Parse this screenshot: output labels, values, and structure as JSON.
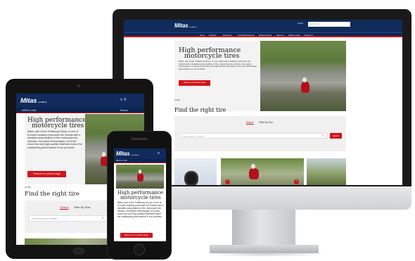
{
  "site": {
    "logo": "Mitas",
    "logo_sub": "by trelleborg",
    "colors": {
      "navy": "#102b5c",
      "red": "#d3141b"
    }
  },
  "monitor": {
    "util_label": "Search",
    "search_placeholder": "Search here",
    "nav": [
      "Home",
      "Products",
      "Motorsport",
      "Technical Resources",
      "Media & Events",
      "About Us",
      "Dealer Locator",
      "Contact Us"
    ],
    "hero_title_1": "High performance",
    "hero_title_2": "motorcycle tires",
    "hero_text": "Mitas, part of the Trelleborg Group, is one of Europe's leading motorcycle tire brands with a decades-long tradition in the motorcycle tire industry. Innovative technologies, in-house know-how and high quality materials ensure the outstanding performance of our products.",
    "hero_button": "Discover our product range",
    "breadcrumb": "HOME",
    "find_title": "Find the right tire",
    "tab_search": "Search",
    "tab_filter": "Filter By Size",
    "input_placeholder": "Product name or number",
    "search_button": "Search"
  },
  "tablet": {
    "sub_left": "MENU & NAV",
    "sub_right": "Search",
    "hero_title_1": "High performance",
    "hero_title_2": "motorcycle tires",
    "hero_text": "Mitas, part of the Trelleborg Group, is one of Europe's leading motorcycle tire brands with a decades-long tradition in the motorcycle tire industry. Innovative technologies, in-house know-how and high quality materials ensure the outstanding performance of our products.",
    "hero_button": "Discover our product range",
    "breadcrumb": "HOME",
    "find_title": "Find the right tire",
    "tab_search": "Search",
    "tab_filter": "Filter By Size",
    "input_placeholder": "Product name or number"
  },
  "phone": {
    "sub_left": "MENU & NAV",
    "hero_title_1": "High performance",
    "hero_title_2": "motorcycle tires",
    "hero_text": "Mitas, part of the Trelleborg Group, is one of Europe's leading motorcycle tire brands with a decades-long tradition in the motorcycle tire industry. Innovative technologies, in-house know-how and high quality materials ensure the outstanding performance of our products.",
    "hero_button": "Discover our product range"
  }
}
